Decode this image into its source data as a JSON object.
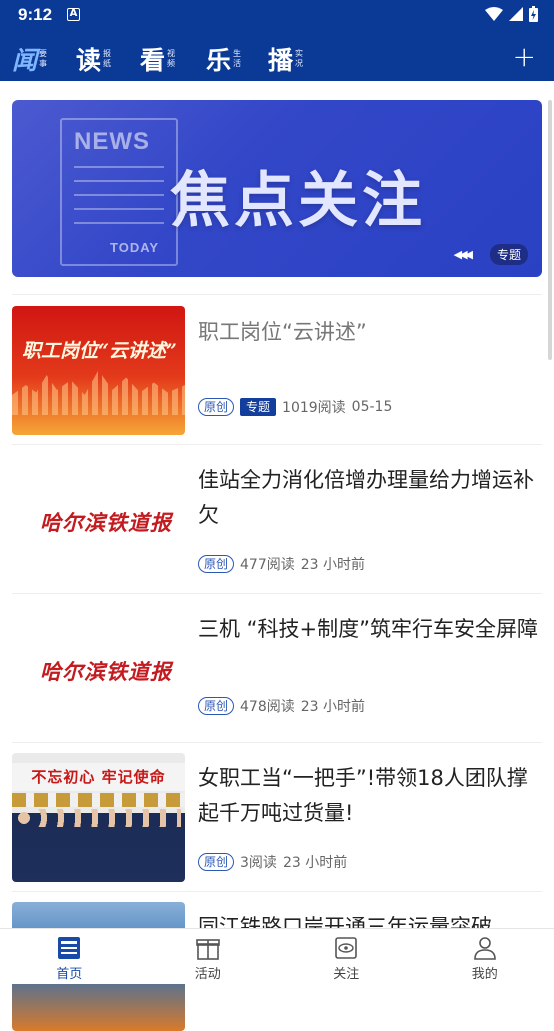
{
  "status_bar": {
    "time": "9:12",
    "notification_badge": "A"
  },
  "header": {
    "brands": [
      {
        "big": "闻",
        "sub": [
          "要",
          "事"
        ]
      },
      {
        "big": "读",
        "sub": [
          "报",
          "纸"
        ]
      },
      {
        "big": "看",
        "sub": [
          "视",
          "频"
        ]
      },
      {
        "big": "乐",
        "sub": [
          "生",
          "活"
        ]
      },
      {
        "big": "播",
        "sub": [
          "实",
          "况"
        ]
      }
    ],
    "plus_label": "+"
  },
  "banner": {
    "news_label": "NEWS",
    "today_label": "TODAY",
    "headline": "焦点关注",
    "arrows": "◀◀◀",
    "badge": "专题"
  },
  "articles": [
    {
      "thumb_text": "职工岗位“云讲述”",
      "title": "职工岗位“云讲述”",
      "tag_original": "原创",
      "tag_topic": "专题",
      "reads": "1019阅读",
      "time": "05-15"
    },
    {
      "thumb_text": "哈尔滨铁道报",
      "title": "佳站全力消化倍增办理量给力增运补欠",
      "tag_original": "原创",
      "reads": "477阅读",
      "time": "23 小时前"
    },
    {
      "thumb_text": "哈尔滨铁道报",
      "title": "三机 “科技+制度”筑牢行车安全屏障",
      "tag_original": "原创",
      "reads": "478阅读",
      "time": "23 小时前"
    },
    {
      "thumb_text": "不忘初心 牢记使命",
      "title": "女职工当“一把手”!带领18人团队撑起千万吨过货量!",
      "tag_original": "原创",
      "reads": "3阅读",
      "time": "23 小时前"
    },
    {
      "title": "同江铁路口岸开通三年运量突破"
    }
  ],
  "tabbar": {
    "tabs": [
      {
        "label": "首页",
        "icon": "news-icon"
      },
      {
        "label": "活动",
        "icon": "gift-icon"
      },
      {
        "label": "关注",
        "icon": "eye-icon"
      },
      {
        "label": "我的",
        "icon": "user-icon"
      }
    ]
  },
  "colors": {
    "primary": "#0b3a96",
    "accent": "#1a4aa8",
    "tag_topic": "#133e9b"
  }
}
